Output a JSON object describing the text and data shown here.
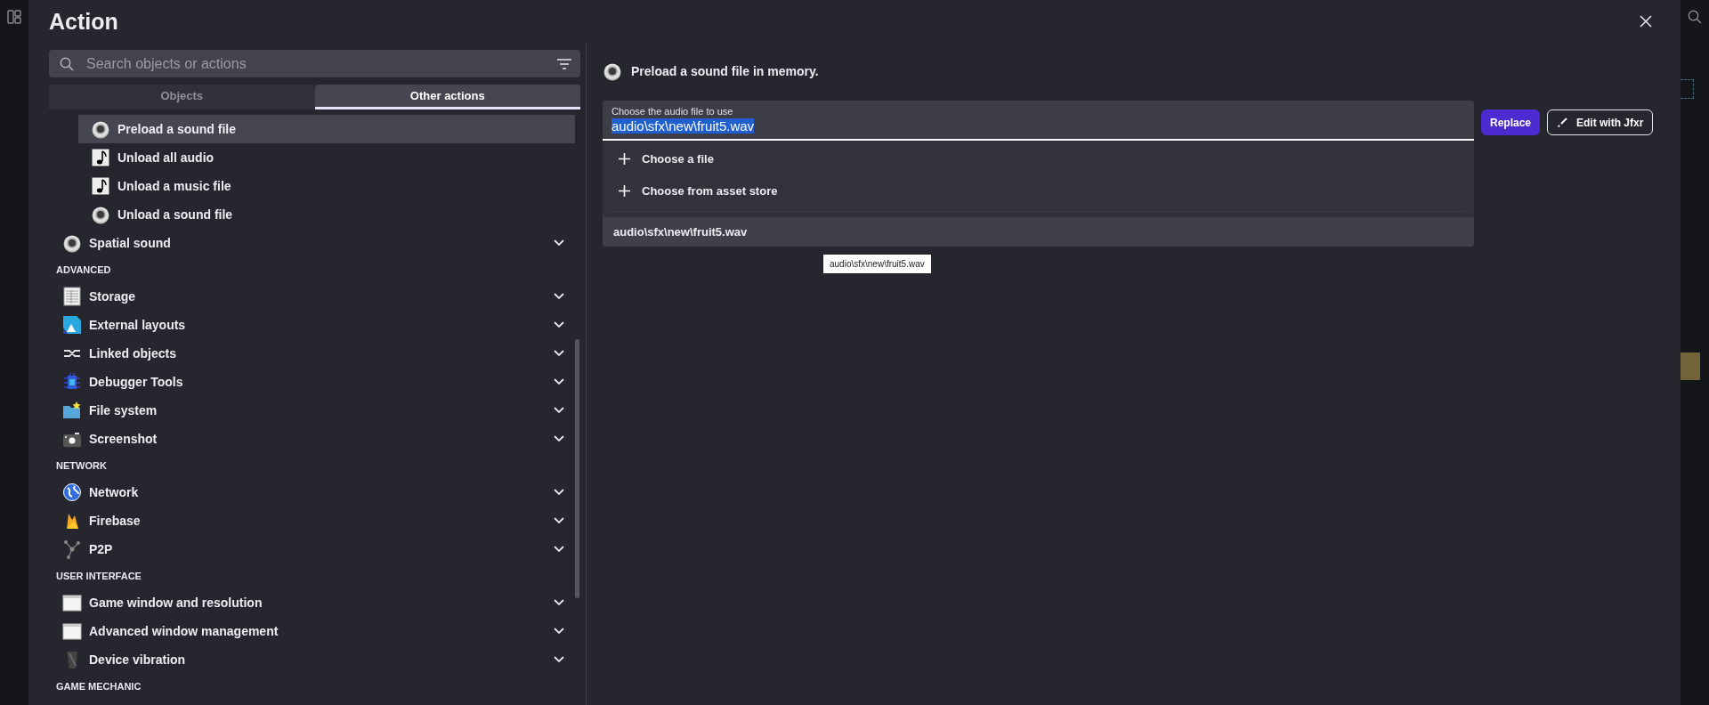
{
  "dialog": {
    "title": "Action"
  },
  "search": {
    "placeholder": "Search objects or actions"
  },
  "tabs": [
    {
      "label": "Objects",
      "selected": false
    },
    {
      "label": "Other actions",
      "selected": true
    }
  ],
  "list": [
    {
      "kind": "action",
      "label": "Preload a sound file",
      "selected": true
    },
    {
      "kind": "action",
      "label": "Unload all audio",
      "selected": false
    },
    {
      "kind": "action",
      "label": "Unload a music file",
      "selected": false
    },
    {
      "kind": "action",
      "label": "Unload a sound file",
      "selected": false
    },
    {
      "kind": "category",
      "label": "Spatial sound",
      "expanded": false
    },
    {
      "kind": "section",
      "label": "ADVANCED"
    },
    {
      "kind": "category",
      "label": "Storage",
      "expanded": false
    },
    {
      "kind": "category",
      "label": "External layouts",
      "expanded": false
    },
    {
      "kind": "category",
      "label": "Linked objects",
      "expanded": false
    },
    {
      "kind": "category",
      "label": "Debugger Tools",
      "expanded": false
    },
    {
      "kind": "category",
      "label": "File system",
      "expanded": false
    },
    {
      "kind": "category",
      "label": "Screenshot",
      "expanded": false
    },
    {
      "kind": "section",
      "label": "NETWORK"
    },
    {
      "kind": "category",
      "label": "Network",
      "expanded": false
    },
    {
      "kind": "category",
      "label": "Firebase",
      "expanded": false
    },
    {
      "kind": "category",
      "label": "P2P",
      "expanded": false
    },
    {
      "kind": "section",
      "label": "USER INTERFACE"
    },
    {
      "kind": "category",
      "label": "Game window and resolution",
      "expanded": false
    },
    {
      "kind": "category",
      "label": "Advanced window management",
      "expanded": false
    },
    {
      "kind": "category",
      "label": "Device vibration",
      "expanded": false
    },
    {
      "kind": "section",
      "label": "GAME MECHANIC"
    }
  ],
  "description": "Preload a sound file in memory.",
  "field": {
    "label": "Choose the audio file to use",
    "value": "audio\\sfx\\new\\fruit5.wav",
    "text_selected": true
  },
  "options": [
    {
      "kind": "add",
      "label": "Choose a file",
      "highlighted": false
    },
    {
      "kind": "add",
      "label": "Choose from asset store",
      "highlighted": false
    },
    {
      "kind": "file",
      "label": "audio\\sfx\\new\\fruit5.wav",
      "highlighted": true
    }
  ],
  "tooltip": "audio\\sfx\\new\\fruit5.wav",
  "buttons": [
    {
      "kind": "primary",
      "label": "Replace"
    },
    {
      "kind": "outline",
      "label": "Edit with Jfxr"
    }
  ]
}
